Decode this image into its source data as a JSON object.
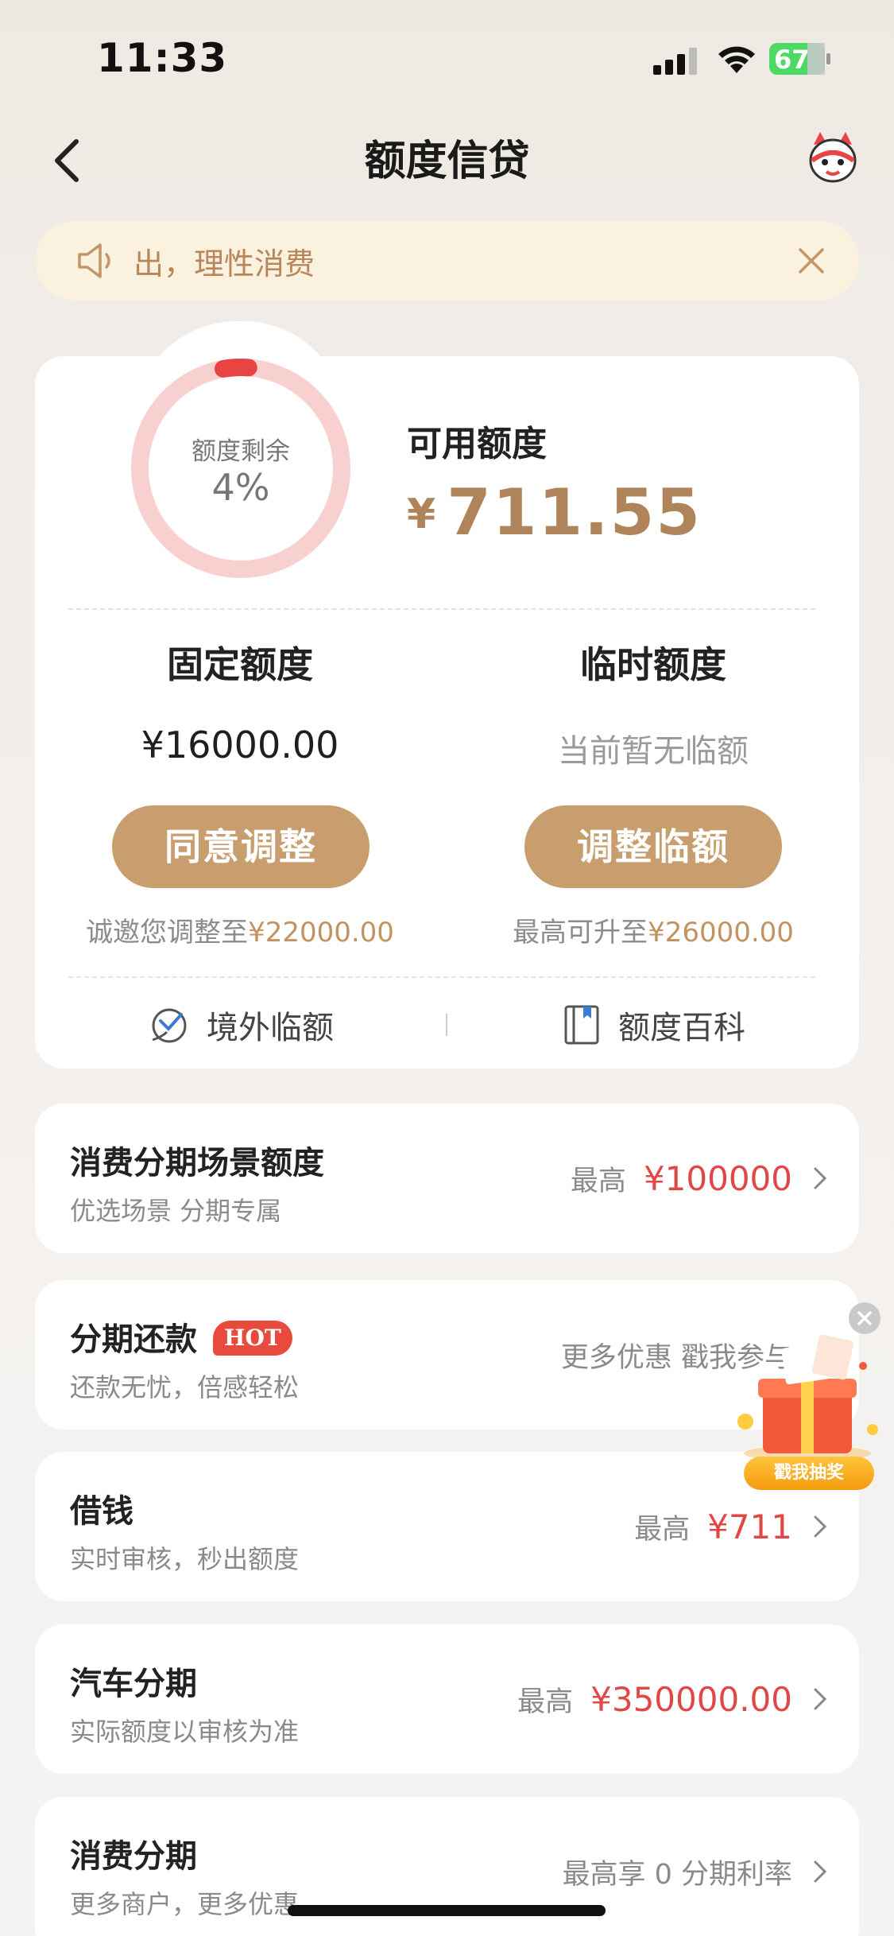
{
  "status_bar": {
    "time": "11:33",
    "battery": "67"
  },
  "nav": {
    "title": "额度信贷"
  },
  "notice": {
    "text": "出，理性消费"
  },
  "credit": {
    "ring_label": "额度剩余",
    "ring_percent_text": "4%",
    "ring_percent": 0.04,
    "available_label": "可用额度",
    "currency": "¥",
    "available_amount": "711.55",
    "fixed": {
      "title": "固定额度",
      "amount": "¥16000.00",
      "button": "同意调整",
      "hint_prefix": "诚邀您调整至",
      "hint_amount": "¥22000.00"
    },
    "temp": {
      "title": "临时额度",
      "status": "当前暂无临额",
      "button": "调整临额",
      "hint_prefix": "最高可升至",
      "hint_amount": "¥26000.00"
    },
    "links": {
      "overseas": "境外临额",
      "wiki": "额度百科"
    }
  },
  "rows": [
    {
      "title": "消费分期场景额度",
      "subtitle": "优选场景 分期专属",
      "right_muted": "最高",
      "right_value": "¥100000"
    },
    {
      "title": "分期还款",
      "badge": "HOT",
      "subtitle": "还款无忧，倍感轻松",
      "right_muted": "更多优惠 戳我参与",
      "right_value": ""
    },
    {
      "title": "借钱",
      "subtitle": "实时审核，秒出额度",
      "right_muted": "最高",
      "right_value": "¥711"
    },
    {
      "title": "汽车分期",
      "subtitle": "实际额度以审核为准",
      "right_muted": "最高",
      "right_value": "¥350000.00"
    },
    {
      "title": "消费分期",
      "subtitle": "更多商户，更多优惠",
      "right_muted": "最高享 0 分期利率",
      "right_value": ""
    }
  ],
  "promo": {
    "button": "戳我抽奖"
  },
  "colors": {
    "gold": "#c99e6e",
    "red": "#e04848",
    "ring_track": "#f9d0d0",
    "ring_fill": "#e84444"
  },
  "icons": [
    "signal-icon",
    "wifi-icon",
    "battery-icon",
    "back-arrow-icon",
    "mascot-icon",
    "speaker-icon",
    "close-icon",
    "globe-plane-icon",
    "book-icon",
    "chevron-right-icon"
  ]
}
